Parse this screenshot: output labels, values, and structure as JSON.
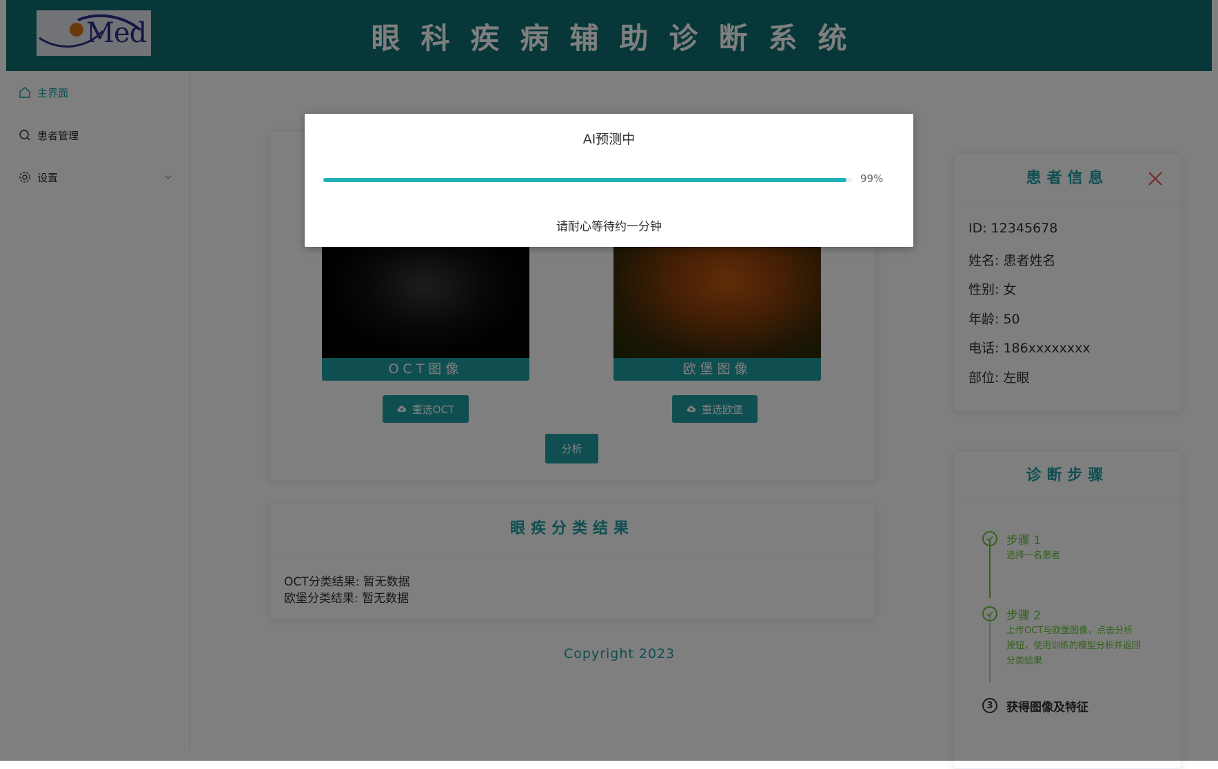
{
  "header": {
    "logo_text": "Med",
    "title": "眼科疾病辅助诊断系统"
  },
  "sidebar": {
    "items": [
      {
        "label": "主界面",
        "icon": "home-icon",
        "active": true
      },
      {
        "label": "患者管理",
        "icon": "search-icon",
        "active": false
      },
      {
        "label": "设置",
        "icon": "gear-icon",
        "active": false,
        "expandable": true
      }
    ]
  },
  "upload": {
    "oct_caption": "OCT图像",
    "fundus_caption": "欧堡图像",
    "reselect_oct_label": "重选OCT",
    "reselect_fundus_label": "重选欧堡",
    "analyze_label": "分析"
  },
  "results": {
    "title": "眼疾分类结果",
    "oct_line": "OCT分类结果: 暂无数据",
    "fundus_line": "欧堡分类结果: 暂无数据"
  },
  "footer": {
    "copyright": "Copyright 2023"
  },
  "patient": {
    "title": "患者信息",
    "id": "ID: 12345678",
    "name": "姓名: 患者姓名",
    "gender": "性别: 女",
    "age": "年龄: 50",
    "phone": "电话: 186xxxxxxxx",
    "side": "部位: 左眼"
  },
  "steps": {
    "title": "诊断步骤",
    "items": [
      {
        "title": "步骤 1",
        "desc": "选择一名患者",
        "status": "done"
      },
      {
        "title": "步骤 2",
        "desc": "上传OCT与欧堡图像，点击分析按钮，使用训练的模型分析并返回分类结果",
        "status": "done"
      },
      {
        "number": "3",
        "title": "获得图像及特征",
        "status": "current"
      }
    ]
  },
  "dialog": {
    "title": "AI预测中",
    "progress_percent": 99,
    "progress_text": "99%",
    "message": "请耐心等待约一分钟"
  },
  "colors": {
    "brand": "#0f6e70",
    "accent": "#1f9ea3",
    "success": "#67c23a",
    "progress": "#20b2b8",
    "close": "#e54d42"
  }
}
